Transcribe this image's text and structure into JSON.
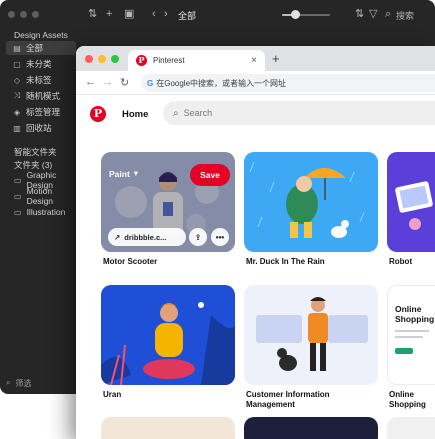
{
  "app": {
    "title": "全部",
    "search_label": "搜索",
    "library_name": "Design Assets",
    "nav_items": [
      {
        "icon": "folder-icon",
        "label": "全部"
      },
      {
        "icon": "unsorted-icon",
        "label": "未分类"
      },
      {
        "icon": "untagged-icon",
        "label": "未标签"
      },
      {
        "icon": "random-icon",
        "label": "随机模式"
      },
      {
        "icon": "tag-manage-icon",
        "label": "标签管理"
      },
      {
        "icon": "trash-icon",
        "label": "回收站"
      }
    ],
    "smart_folders_header": "智能文件夹",
    "folders_header": "文件夹 (3)",
    "folders": [
      "Graphic Design",
      "Motion Design",
      "Illustration"
    ],
    "filter_label": "筛选"
  },
  "browser": {
    "tab_title": "Pinterest",
    "address_placeholder": "在Google中搜索，或者输入一个网址",
    "google_mark": "G"
  },
  "pinterest": {
    "home_label": "Home",
    "search_placeholder": "Search",
    "hover": {
      "board_select": "Paint",
      "save_label": "Save",
      "source_link": "dribbble.c..."
    },
    "pins": [
      {
        "caption": "Motor Scooter"
      },
      {
        "caption": "Mr. Duck In The Rain"
      },
      {
        "caption": "Robot"
      },
      {
        "caption": "Uran"
      },
      {
        "caption": "Customer Information Management"
      },
      {
        "caption": "Online Shopping",
        "card_text": "Online Shopping"
      }
    ]
  },
  "colors": {
    "pinterest_red": "#e60023",
    "app_bg": "#262626"
  }
}
